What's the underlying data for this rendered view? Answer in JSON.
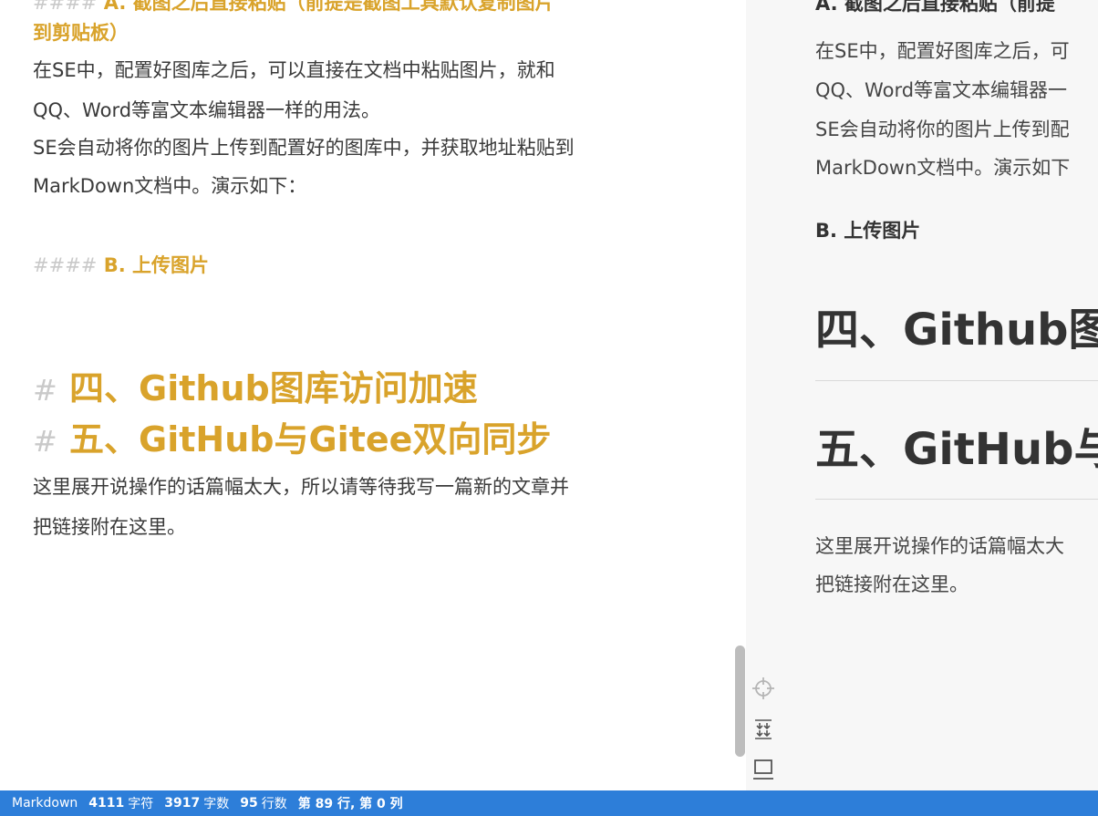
{
  "editor": {
    "h4a_marks": "####",
    "h4a_line1": "A. 截图之后直接粘贴（前提是截图工具默认复制图片",
    "h4a_line2": "到剪贴板）",
    "p1_line1": "在SE中，配置好图库之后，可以直接在文档中粘贴图片，就和",
    "p1_line2": "QQ、Word等富文本编辑器一样的用法。",
    "p1_line3": "SE会自动将你的图片上传到配置好的图库中，并获取地址粘贴到",
    "p1_line4": "MarkDown文档中。演示如下：",
    "h4b_marks": "####",
    "h4b_text": "B. 上传图片",
    "h1a_mark": "#",
    "h1a_text": "四、Github图库访问加速",
    "h1b_mark": "#",
    "h1b_text": "五、GitHub与Gitee双向同步",
    "p2_line1": "这里展开说操作的话篇幅太大，所以请等待我写一篇新的文章并",
    "p2_line2": "把链接附在这里。"
  },
  "preview": {
    "h4a": "A. 截图之后直接粘贴（前提",
    "p1_line1": "在SE中，配置好图库之后，可",
    "p1_line2": "QQ、Word等富文本编辑器一",
    "p1_line3": "SE会自动将你的图片上传到配",
    "p1_line4": "MarkDown文档中。演示如下",
    "h4b": "B. 上传图片",
    "h1a": "四、Github图库",
    "h1b": "五、GitHub与Gi",
    "p2_line1": "这里展开说操作的话篇幅太大",
    "p2_line2": "把链接附在这里。"
  },
  "tools": {
    "icons": [
      "crosshair-icon",
      "sync-scroll-icon",
      "toggle-preview-icon"
    ]
  },
  "statusbar": {
    "mode": "Markdown",
    "chars_count": "4111",
    "chars_label": "字符",
    "words_count": "3917",
    "words_label": "字数",
    "lines_count": "95",
    "lines_label": "行数",
    "cursor": "第 89 行, 第 0 列"
  },
  "colors": {
    "heading_gold": "#d9a32b",
    "statusbar_blue": "#2d7ed9",
    "preview_bg": "#f7f7f7"
  }
}
